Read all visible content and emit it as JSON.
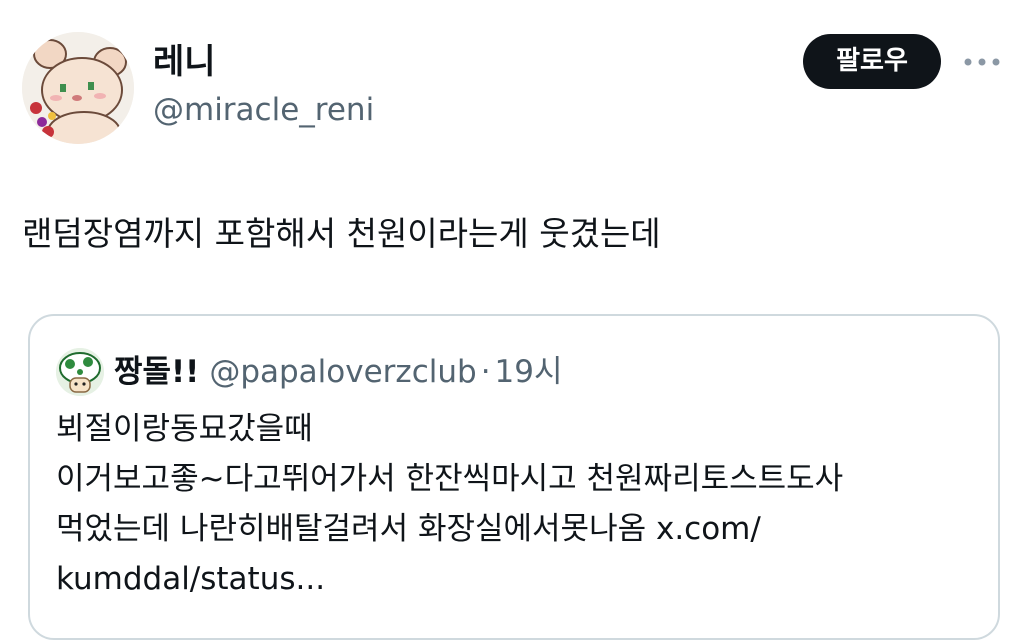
{
  "author": {
    "display_name": "레니",
    "handle": "@miracle_reni",
    "avatar_icon": "bear-plush-avatar"
  },
  "actions": {
    "follow_label": "팔로우",
    "more_icon": "more-dots-icon"
  },
  "tweet": {
    "text": "랜덤장염까지 포함해서 천원이라는게 웃겼는데"
  },
  "quote": {
    "display_name": "짱돌!!",
    "handle": "@papaloverzclub",
    "separator": "·",
    "time": "19시",
    "avatar_icon": "mushroom-avatar",
    "lines": [
      "뵈절이랑동묘갔을때",
      "이거보고좋~다고뛰어가서 한잔씩마시고 천원짜리토스트도사",
      "먹었는데 나란히배탈걸려서 화장실에서못나옴",
      "kumddal/status..."
    ],
    "link_start": "x.com/"
  },
  "colors": {
    "text_primary": "#0f1419",
    "text_secondary": "#536471",
    "border": "#cfd9de",
    "button_bg": "#0f1419",
    "button_text": "#ffffff"
  }
}
